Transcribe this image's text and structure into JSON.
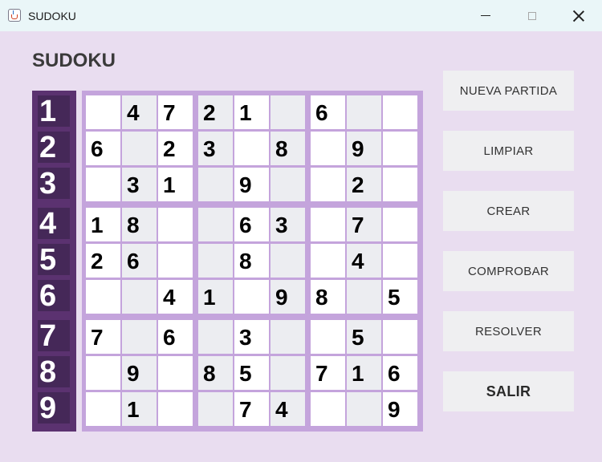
{
  "window": {
    "title": "SUDOKU"
  },
  "heading": "SUDOKU",
  "row_labels": [
    "1",
    "2",
    "3",
    "4",
    "5",
    "6",
    "7",
    "8",
    "9"
  ],
  "grid": [
    [
      "",
      "4",
      "7",
      "2",
      "1",
      "",
      "6",
      "",
      ""
    ],
    [
      "6",
      "",
      "2",
      "3",
      "",
      "8",
      "",
      "9",
      ""
    ],
    [
      "",
      "3",
      "1",
      "",
      "9",
      "",
      "",
      "2",
      ""
    ],
    [
      "1",
      "8",
      "",
      "",
      "6",
      "3",
      "",
      "7",
      ""
    ],
    [
      "2",
      "6",
      "",
      "",
      "8",
      "",
      "",
      "4",
      ""
    ],
    [
      "",
      "",
      "4",
      "1",
      "",
      "9",
      "8",
      "",
      "5"
    ],
    [
      "7",
      "",
      "6",
      "",
      "3",
      "",
      "",
      "5",
      ""
    ],
    [
      "",
      "9",
      "",
      "8",
      "5",
      "",
      "7",
      "1",
      "6"
    ],
    [
      "",
      "1",
      "",
      "",
      "7",
      "4",
      "",
      "",
      "9"
    ]
  ],
  "buttons": {
    "nueva_partida": "NUEVA  PARTIDA",
    "limpiar": "LIMPIAR",
    "crear": "CREAR",
    "comprobar": "COMPROBAR",
    "resolver": "RESOLVER",
    "salir": "SALIR"
  },
  "colors": {
    "background": "#e9ddf0",
    "board_border": "#c4a4dc",
    "row_label_panel": "#5b3270",
    "row_label_cell": "#452858"
  },
  "icons": {
    "app": "java-icon",
    "minimize": "minimize-icon",
    "maximize": "maximize-icon",
    "close": "close-icon"
  }
}
